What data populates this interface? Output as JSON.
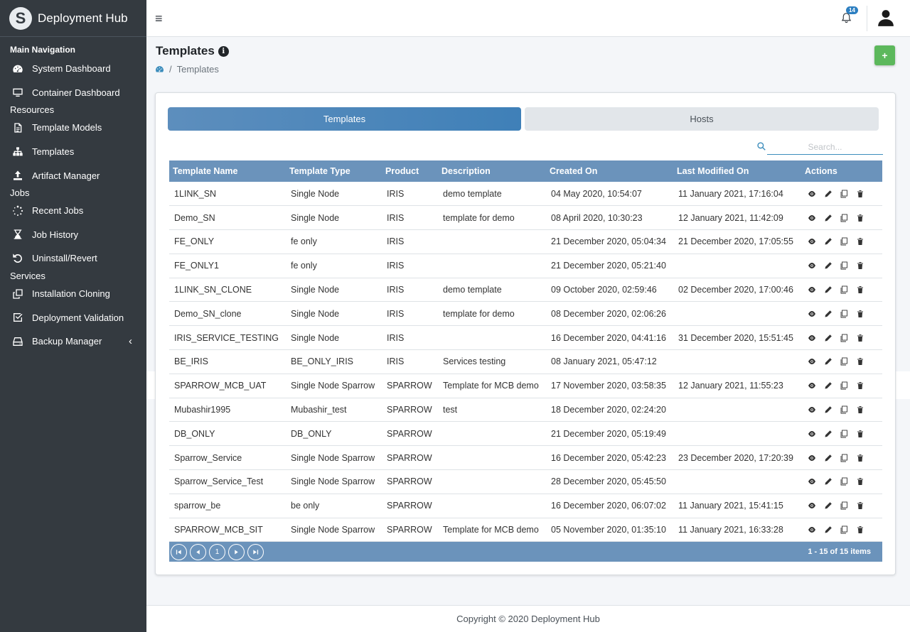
{
  "app": {
    "brand": "Deployment Hub",
    "logo_letter": "S"
  },
  "sidebar": {
    "main_header": "Main Navigation",
    "main_items": [
      {
        "label": "System Dashboard",
        "icon": "tachometer-icon"
      },
      {
        "label": "Container Dashboard",
        "icon": "monitor-icon"
      }
    ],
    "resources_header": "Resources",
    "resources_items": [
      {
        "label": "Template Models",
        "icon": "file-icon"
      },
      {
        "label": "Templates",
        "icon": "sitemap-icon"
      },
      {
        "label": "Artifact Manager",
        "icon": "upload-icon"
      }
    ],
    "jobs_header": "Jobs",
    "jobs_items": [
      {
        "label": "Recent Jobs",
        "icon": "spinner-icon"
      },
      {
        "label": "Job History",
        "icon": "hourglass-icon"
      },
      {
        "label": "Uninstall/Revert",
        "icon": "undo-icon"
      }
    ],
    "services_header": "Services",
    "services_items": [
      {
        "label": "Installation Cloning",
        "icon": "clone-icon"
      },
      {
        "label": "Deployment Validation",
        "icon": "check-square-icon"
      },
      {
        "label": "Backup Manager",
        "icon": "hdd-icon"
      }
    ],
    "collapse_glyph": "‹"
  },
  "topbar": {
    "menu_glyph": "≡",
    "notification_count": "14"
  },
  "page": {
    "title": "Templates",
    "breadcrumb_current": "Templates",
    "breadcrumb_separator": "/",
    "add_glyph": "+"
  },
  "tabs": {
    "active": "Templates",
    "inactive": "Hosts"
  },
  "search": {
    "placeholder": "Search...",
    "value": ""
  },
  "table": {
    "columns": [
      "Template Name",
      "Template Type",
      "Product",
      "Description",
      "Created On",
      "Last Modified On",
      "Actions"
    ],
    "rows": [
      [
        "1LINK_SN",
        "Single Node",
        "IRIS",
        "demo template",
        "04 May 2020, 10:54:07",
        "11 January 2021, 17:16:04"
      ],
      [
        "Demo_SN",
        "Single Node",
        "IRIS",
        "template for demo",
        "08 April 2020, 10:30:23",
        "12 January 2021, 11:42:09"
      ],
      [
        "FE_ONLY",
        "fe only",
        "IRIS",
        "",
        "21 December 2020, 05:04:34",
        "21 December 2020, 17:05:55"
      ],
      [
        "FE_ONLY1",
        "fe only",
        "IRIS",
        "",
        "21 December 2020, 05:21:40",
        ""
      ],
      [
        "1LINK_SN_CLONE",
        "Single Node",
        "IRIS",
        "demo template",
        "09 October 2020, 02:59:46",
        "02 December 2020, 17:00:46"
      ],
      [
        "Demo_SN_clone",
        "Single Node",
        "IRIS",
        "template for demo",
        "08 December 2020, 02:06:26",
        ""
      ],
      [
        "IRIS_SERVICE_TESTING",
        "Single Node",
        "IRIS",
        "",
        "16 December 2020, 04:41:16",
        "31 December 2020, 15:51:45"
      ],
      [
        "BE_IRIS",
        "BE_ONLY_IRIS",
        "IRIS",
        "Services testing",
        "08 January 2021, 05:47:12",
        ""
      ],
      [
        "SPARROW_MCB_UAT",
        "Single Node Sparrow",
        "SPARROW",
        "Template for MCB demo",
        "17 November 2020, 03:58:35",
        "12 January 2021, 11:55:23"
      ],
      [
        "Mubashir1995",
        "Mubashir_test",
        "SPARROW",
        "test",
        "18 December 2020, 02:24:20",
        ""
      ],
      [
        "DB_ONLY",
        "DB_ONLY",
        "SPARROW",
        "",
        "21 December 2020, 05:19:49",
        ""
      ],
      [
        "Sparrow_Service",
        "Single Node Sparrow",
        "SPARROW",
        "",
        "16 December 2020, 05:42:23",
        "23 December 2020, 17:20:39"
      ],
      [
        "Sparrow_Service_Test",
        "Single Node Sparrow",
        "SPARROW",
        "",
        "28 December 2020, 05:45:50",
        ""
      ],
      [
        "sparrow_be",
        "be only",
        "SPARROW",
        "",
        "16 December 2020, 06:07:02",
        "11 January 2021, 15:41:15"
      ],
      [
        "SPARROW_MCB_SIT",
        "Single Node Sparrow",
        "SPARROW",
        "Template for MCB demo",
        "05 November 2020, 01:35:10",
        "11 January 2021, 16:33:28"
      ]
    ]
  },
  "pager": {
    "current_page": "1",
    "info": "1 - 15 of 15 items"
  },
  "footer": {
    "text": "Copyright © 2020 Deployment Hub"
  },
  "colors": {
    "sidebar_bg": "#343a40",
    "header_bg": "#6b93bb",
    "accent": "#3c8dbc",
    "add_button": "#5cb85c"
  }
}
